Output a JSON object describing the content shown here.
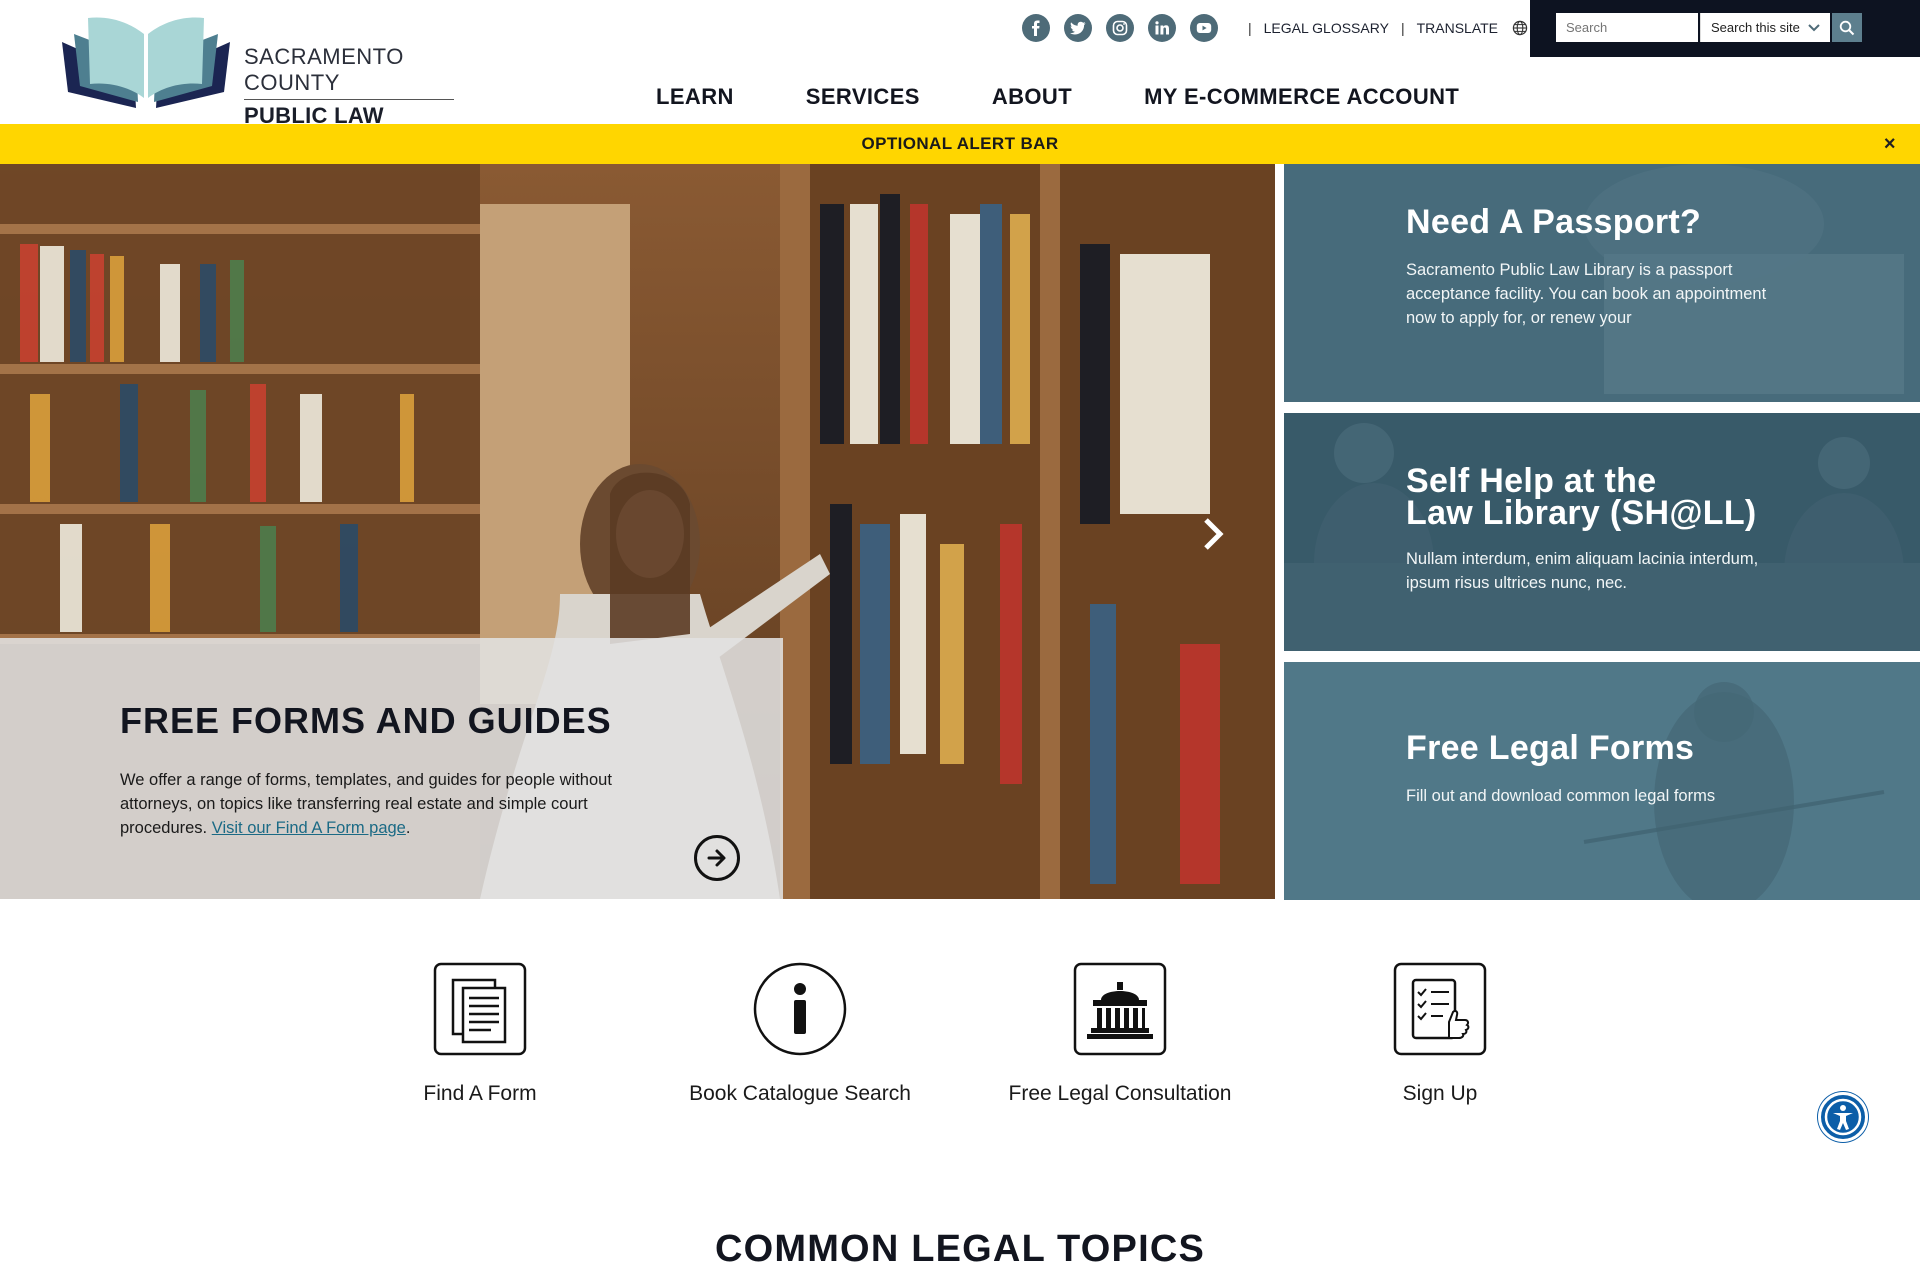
{
  "header": {
    "logo_line1": "SACRAMENTO COUNTY",
    "logo_line2": "PUBLIC LAW LIBRARY",
    "social_icons": [
      "facebook-icon",
      "twitter-icon",
      "instagram-icon",
      "linkedin-icon",
      "youtube-icon"
    ],
    "utility_links": {
      "separator": "|",
      "glossary": "LEGAL GLOSSARY",
      "translate": "TRANSLATE"
    },
    "search": {
      "placeholder": "Search",
      "scope": "Search this site"
    },
    "nav": [
      "LEARN",
      "SERVICES",
      "ABOUT",
      "MY E-COMMERCE ACCOUNT"
    ]
  },
  "alert": {
    "text": "OPTIONAL ALERT BAR",
    "close": "×"
  },
  "hero": {
    "title": "FREE FORMS AND GUIDES",
    "body": "We offer a range of forms, templates, and guides for people without attorneys, on topics like transferring real estate and simple court procedures.",
    "link": "Visit our Find A Form page",
    "link_suffix": "."
  },
  "cards": [
    {
      "title": "Need A Passport?",
      "body": "Sacramento Public Law Library is a passport acceptance facility. You can book an appointment now to apply for, or renew your"
    },
    {
      "title_line1": "Self Help at the",
      "title_line2": "Law Library (SH@LL)",
      "body": "Nullam interdum, enim aliquam lacinia interdum, ipsum risus ultrices nunc, nec."
    },
    {
      "title": "Free Legal Forms",
      "body": "Fill out and download common legal forms"
    }
  ],
  "quick_links": [
    {
      "label": "Find A Form",
      "icon": "document-icon"
    },
    {
      "label": "Book Catalogue Search",
      "icon": "info-icon"
    },
    {
      "label": "Free Legal Consultation",
      "icon": "courthouse-icon"
    },
    {
      "label": "Sign Up",
      "icon": "checklist-thumbs-up-icon"
    }
  ],
  "section_title": "COMMON LEGAL TOPICS",
  "colors": {
    "alert": "#ffd600",
    "card_overlay": "#4f7384",
    "search_panel": "#0d1321",
    "link": "#1b6a85",
    "accessibility": "#0c5ea8"
  }
}
